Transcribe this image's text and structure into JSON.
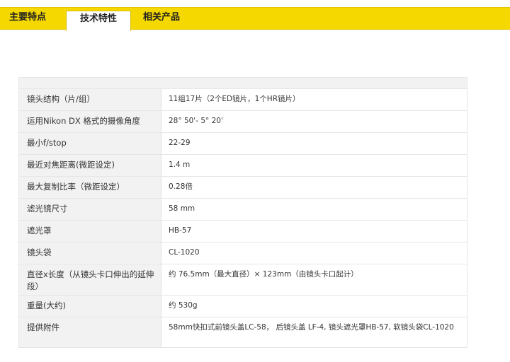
{
  "tabs": [
    {
      "label": "主要特点"
    },
    {
      "label": "技术特性"
    },
    {
      "label": "相关产品"
    }
  ],
  "specs": [
    {
      "label": "镜头结构（片/组）",
      "value": "11组17片（2个ED镜片，1个HR镜片）"
    },
    {
      "label": "运用Nikon DX 格式的摄像角度",
      "value": "28° 50'- 5° 20'"
    },
    {
      "label": "最小f/stop",
      "value": "22-29"
    },
    {
      "label": "最近对焦距离(微距设定)",
      "value": "1.4 m"
    },
    {
      "label": "最大复制比率（微距设定）",
      "value": "0.28倍"
    },
    {
      "label": "滤光镜尺寸",
      "value": "58 mm"
    },
    {
      "label": "遮光罩",
      "value": "HB-57"
    },
    {
      "label": "镜头袋",
      "value": "CL-1020"
    },
    {
      "label": "直径x长度（从镜头卡口伸出的延伸段）",
      "value": "约 76.5mm（最大直径）× 123mm（由镜头卡口起计）"
    },
    {
      "label": "重量(大约)",
      "value": "约 530g"
    },
    {
      "label": "提供附件",
      "value": "58mm快扣式前镜头盖LC-58， 后镜头盖 LF-4, 镜头遮光罩HB-57, 软镜头袋CL-1020"
    }
  ]
}
